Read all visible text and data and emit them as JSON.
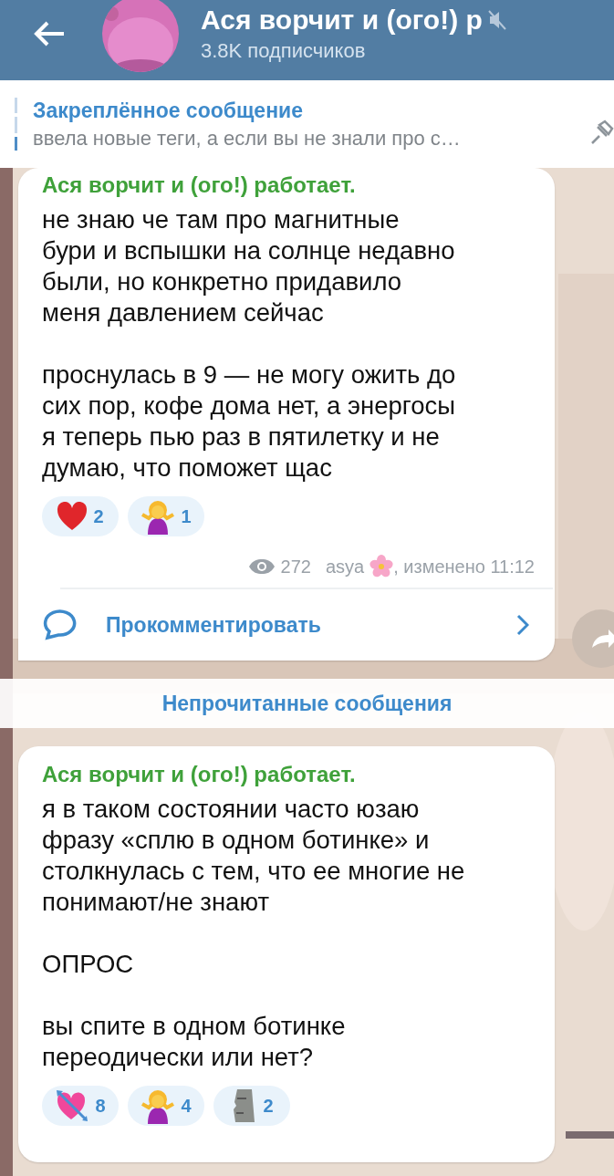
{
  "header": {
    "title": "Ася ворчит и (ого!) р",
    "muted": true,
    "subtitle": "3.8K подписчиков"
  },
  "pinned": {
    "title": "Закреплённое сообщение",
    "text": "ввела новые теги, а если вы не знали про с…"
  },
  "messages": [
    {
      "author": "Ася ворчит и (ого!) работает.",
      "text": "не знаю че там про магнитные\nбури и вспышки на солнце недавно\nбыли, но конкретно придавило\nменя давлением сейчас\n\nпроснулась в 9 — не могу ожить до\nсих пор, кофе дома нет, а энергосы\nя теперь пью раз в пятилетку и не\nдумаю, что поможет щас",
      "reactions": [
        {
          "kind": "heart",
          "count": "2"
        },
        {
          "kind": "shrug",
          "count": "1"
        }
      ],
      "views": "272",
      "signature": "asya",
      ",edited": ", изменено 11:12",
      "comment": "Прокомментировать"
    },
    {
      "author": "Ася ворчит и (ого!) работает.",
      "text": "я в таком состоянии часто юзаю\nфразу «сплю в одном ботинке» и\nстолкнулась с тем, что ее многие не\nпонимают/не знают\n\nОПРОС\n\nвы спите в одном ботинке\nпереодически или нет?",
      "reactions": [
        {
          "kind": "arrow-heart",
          "count": "8"
        },
        {
          "kind": "shrug",
          "count": "4"
        },
        {
          "kind": "moai",
          "count": "2"
        }
      ]
    }
  ],
  "unread": "Непрочитанные сообщения"
}
